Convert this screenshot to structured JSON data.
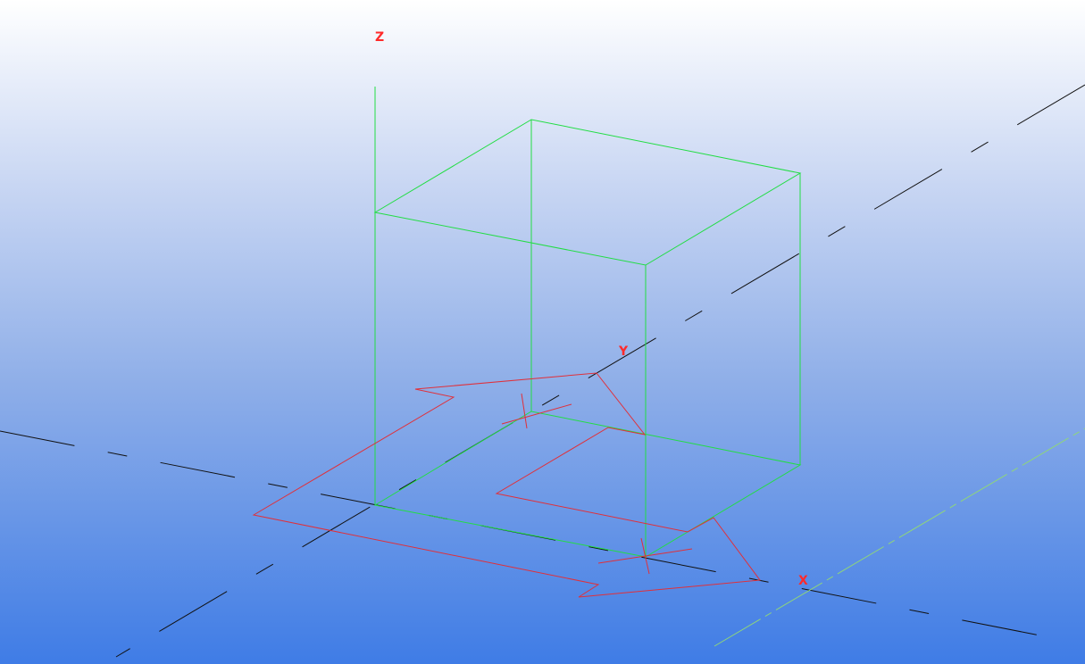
{
  "viewport": {
    "background_top": "#ffffff",
    "background_bottom": "#3f7ce6"
  },
  "axes": {
    "x_label": "X",
    "y_label": "Y",
    "z_label": "Z",
    "label_color": "#ff2a2a"
  },
  "colors": {
    "box_edges": "#22dd44",
    "shape_outline": "#e0303a",
    "grid_lines": "#111111",
    "secondary_line": "#7fd46a"
  }
}
